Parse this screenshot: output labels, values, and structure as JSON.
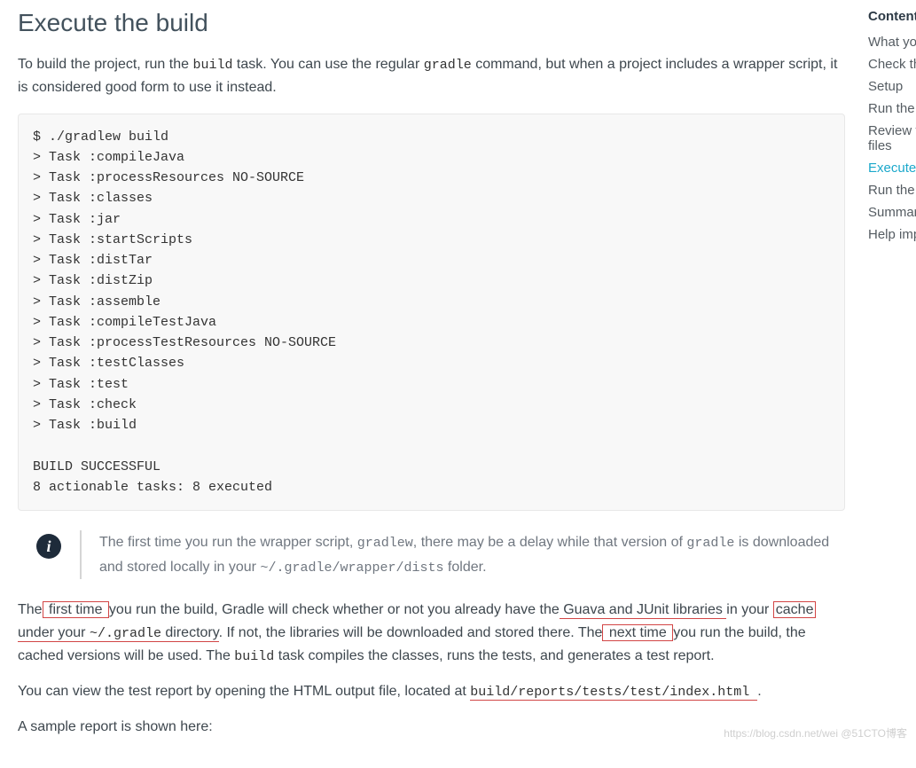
{
  "header": {
    "title": "Execute the build"
  },
  "intro": {
    "seg1": "To build the project, run the ",
    "code1": "build",
    "seg2": " task. You can use the regular ",
    "code2": "gradle",
    "seg3": " command, but when a project includes a wrapper script, it is considered good form to use it instead."
  },
  "code_block": "$ ./gradlew build\n> Task :compileJava\n> Task :processResources NO-SOURCE\n> Task :classes\n> Task :jar\n> Task :startScripts\n> Task :distTar\n> Task :distZip\n> Task :assemble\n> Task :compileTestJava\n> Task :processTestResources NO-SOURCE\n> Task :testClasses\n> Task :test\n> Task :check\n> Task :build\n\nBUILD SUCCESSFUL\n8 actionable tasks: 8 executed",
  "info": {
    "seg1": "The first time you run the wrapper script, ",
    "code1": "gradlew",
    "seg2": ", there may be a delay while that version of ",
    "code2": "gradle",
    "seg3": " is downloaded and stored locally in your ",
    "code3": "~/.gradle/wrapper/dists",
    "seg4": " folder."
  },
  "para2": {
    "seg1": "The",
    "box1": " first time ",
    "seg2": "you run the build, Gradle will check whether or not you already have the",
    "under1": " Guava and JUnit libraries ",
    "seg3": "in your ",
    "box2": "cache",
    "under2": " under your ",
    "code1": "~/.gradle",
    "under3": " directory",
    "seg4": ". If not, the libraries will be downloaded and stored there. The",
    "box3": " next time ",
    "seg5": "you run the build, the cached versions will be used. The ",
    "code2": "build",
    "seg6": " task compiles the classes, runs the tests, and generates a test report."
  },
  "para3": {
    "seg1": "You can view the test report by opening the HTML output file, located at ",
    "under1": " build/reports/tests/test/index.html ",
    "seg2": "."
  },
  "para4": "A sample report is shown here:",
  "sidebar": {
    "title": "Content",
    "items": [
      {
        "label": "What yo",
        "active": false
      },
      {
        "label": "Check th",
        "active": false
      },
      {
        "label": "Setup",
        "active": false
      },
      {
        "label": "Run the",
        "active": false
      },
      {
        "label": "Review t",
        "active": false,
        "line2": "files"
      },
      {
        "label": "Execute",
        "active": true
      },
      {
        "label": "Run the",
        "active": false
      },
      {
        "label": "Summar",
        "active": false
      },
      {
        "label": "Help imp",
        "active": false
      }
    ]
  },
  "watermark": "https://blog.csdn.net/wei  @51CTO博客"
}
